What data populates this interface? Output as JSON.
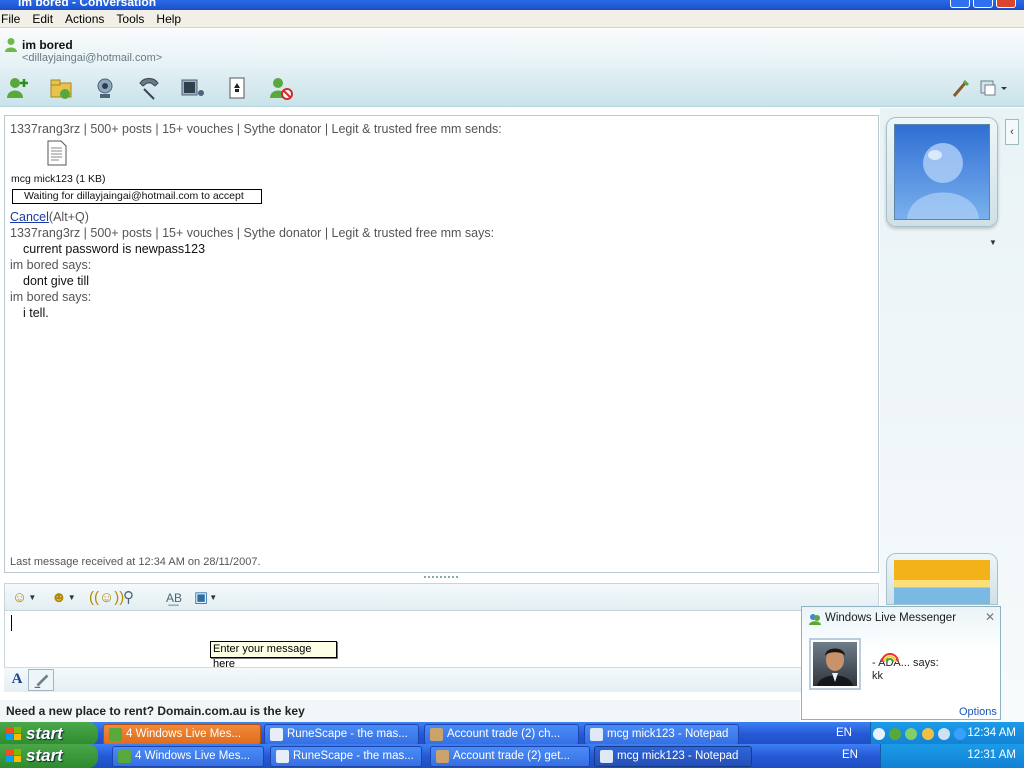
{
  "window": {
    "title": "im bored - Conversation"
  },
  "menu": [
    "File",
    "Edit",
    "Actions",
    "Tools",
    "Help"
  ],
  "contact": {
    "name": "im bored",
    "email": "<dillayjaingai@hotmail.com>"
  },
  "conversation": {
    "file_send_header": "1337rang3rz | 500+ posts | 15+ vouches | Sythe donator | Legit & trusted free mm sends:",
    "file_label": "mcg mick123 (1 KB)",
    "waiting_text": "Waiting for dillayjaingai@hotmail.com to accept",
    "cancel_label": "Cancel",
    "cancel_shortcut": "(Alt+Q)",
    "messages": [
      {
        "sender": "1337rang3rz | 500+ posts | 15+ vouches | Sythe donator | Legit & trusted free mm says:",
        "text": "current password is newpass123"
      },
      {
        "sender": "im bored says:",
        "text": "dont give till"
      },
      {
        "sender": "im bored says:",
        "text": "i tell."
      }
    ],
    "last_received": "Last message received at 12:34 AM on 28/11/2007."
  },
  "input": {
    "tooltip": "Enter your message here"
  },
  "ad": {
    "text": "Need a new place to rent? Domain.com.au is the key"
  },
  "toast": {
    "title": "Windows Live Messenger",
    "sender": "- ADA... says:",
    "message": "kk",
    "options": "Options"
  },
  "taskbar1": {
    "start": "start",
    "tasks": [
      "4 Windows Live Mes...",
      "RuneScape - the mas...",
      "Account trade (2) ch...",
      "mcg mick123 - Notepad"
    ],
    "lang": "EN",
    "clock": "12:34 AM"
  },
  "taskbar2": {
    "start": "start",
    "tasks": [
      "4 Windows Live Mes...",
      "RuneScape - the mas...",
      "Account trade (2) get...",
      "mcg mick123 - Notepad"
    ],
    "lang": "EN",
    "clock": "12:31 AM"
  },
  "colors": {
    "accent": "#2659d6",
    "link": "#1a3aa8",
    "active_task": "#e06c1c"
  }
}
